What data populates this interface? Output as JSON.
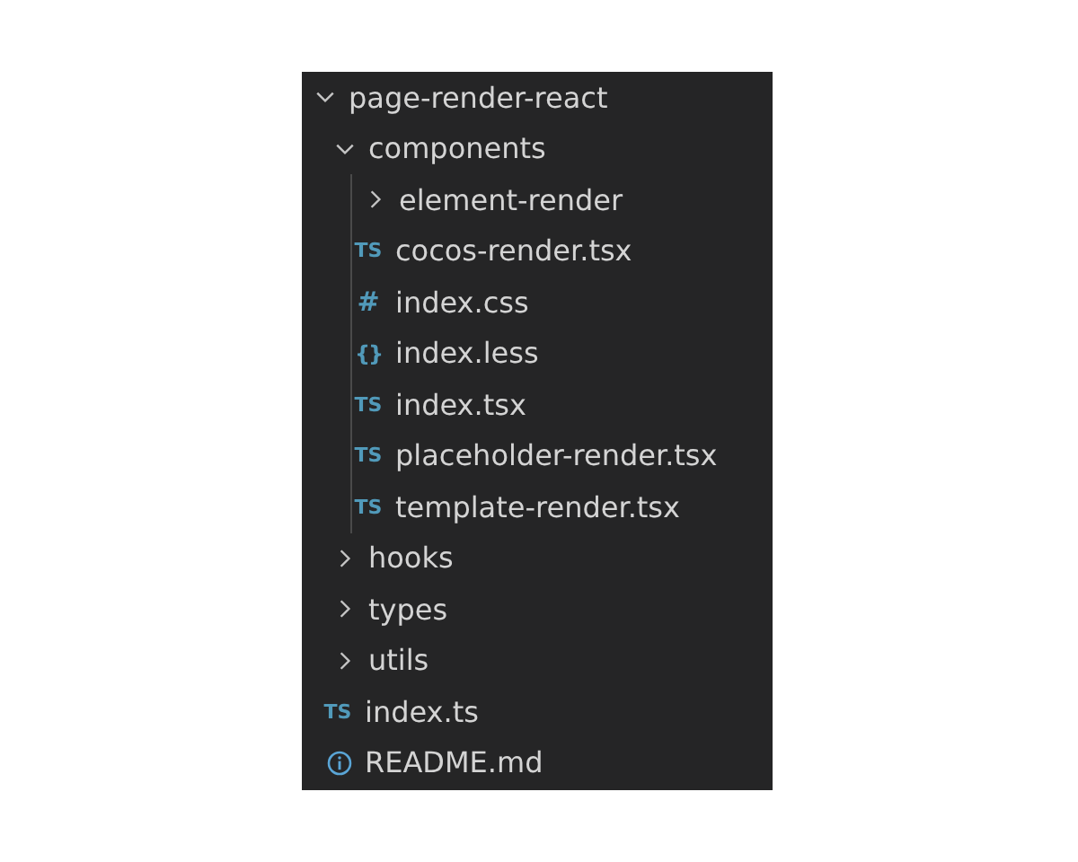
{
  "explorer": {
    "tree": [
      {
        "kind": "folder",
        "name": "page-render-react",
        "expanded": true,
        "children": [
          {
            "kind": "folder",
            "name": "components",
            "expanded": true,
            "children": [
              {
                "kind": "folder",
                "name": "element-render",
                "expanded": false
              },
              {
                "kind": "ts",
                "badge": "TS",
                "name": "cocos-render.tsx"
              },
              {
                "kind": "css",
                "badge": "#",
                "name": "index.css"
              },
              {
                "kind": "less",
                "badge": "{}",
                "name": "index.less"
              },
              {
                "kind": "ts",
                "badge": "TS",
                "name": "index.tsx"
              },
              {
                "kind": "ts",
                "badge": "TS",
                "name": "placeholder-render.tsx"
              },
              {
                "kind": "ts",
                "badge": "TS",
                "name": "template-render.tsx"
              }
            ]
          },
          {
            "kind": "folder",
            "name": "hooks",
            "expanded": false
          },
          {
            "kind": "folder",
            "name": "types",
            "expanded": false
          },
          {
            "kind": "folder",
            "name": "utils",
            "expanded": false
          },
          {
            "kind": "ts",
            "badge": "TS",
            "name": "index.ts"
          },
          {
            "kind": "info",
            "name": "README.md"
          }
        ]
      }
    ]
  }
}
